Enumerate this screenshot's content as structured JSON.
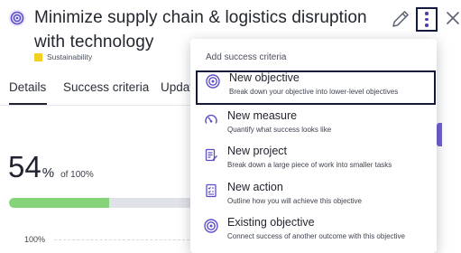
{
  "header": {
    "title": "Minimize supply chain & logistics disruption with technology",
    "tag_label": "Sustainability",
    "tag_color": "#f2d01e",
    "edit_icon": "pencil-icon",
    "more_icon": "kebab-icon",
    "close_icon": "close-icon"
  },
  "tabs": [
    {
      "label": "Details",
      "active": true
    },
    {
      "label": "Success criteria",
      "active": false
    },
    {
      "label": "Updat",
      "active": false
    }
  ],
  "progress": {
    "value": "54",
    "unit": "%",
    "of_text": "of 100%",
    "fraction": 0.54,
    "fill_color": "#86d47a",
    "axis_label": "100%"
  },
  "menu": {
    "header": "Add success criteria",
    "items": [
      {
        "label": "New objective",
        "description": "Break down your objective into lower-level objectives",
        "icon": "target-icon",
        "selected": true
      },
      {
        "label": "New measure",
        "description": "Quantify what success looks like",
        "icon": "gauge-icon",
        "selected": false
      },
      {
        "label": "New project",
        "description": "Break down a large piece of work into smaller tasks",
        "icon": "clipboard-icon",
        "selected": false
      },
      {
        "label": "New action",
        "description": "Outline how you will achieve this objective",
        "icon": "checklist-icon",
        "selected": false
      },
      {
        "label": "Existing objective",
        "description": "Connect success of another outcome with this objective",
        "icon": "target-icon",
        "selected": false
      }
    ]
  },
  "colors": {
    "accent": "#6f60d6",
    "highlight_border": "#141a3c"
  }
}
